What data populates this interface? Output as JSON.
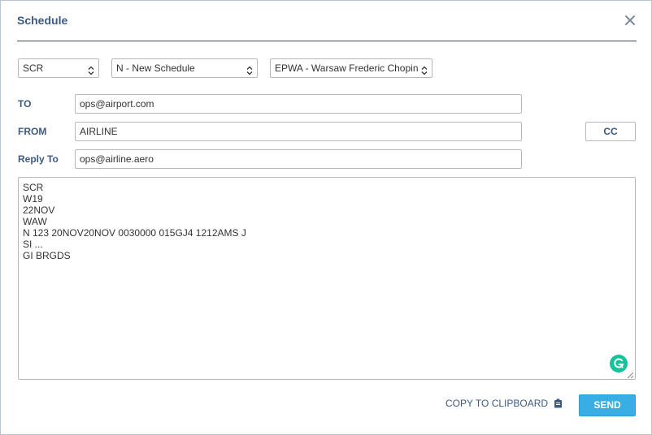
{
  "dialog": {
    "title": "Schedule"
  },
  "selects": {
    "message_type": "SCR",
    "action": "N - New Schedule",
    "airport": "EPWA - Warsaw Frederic Chopin"
  },
  "fields": {
    "to_label": "TO",
    "to_value": "ops@airport.com",
    "from_label": "FROM",
    "from_value": "AIRLINE",
    "reply_label": "Reply To",
    "reply_value": "ops@airline.aero",
    "cc_label": "CC"
  },
  "message": {
    "lines": [
      "SCR",
      "W19",
      "22NOV",
      "WAW",
      "N 123 20NOV20NOV 0030000 015GJ4 1212AMS J",
      "SI ...",
      "GI BRGDS"
    ]
  },
  "footer": {
    "copy_label": "COPY TO CLIPBOARD",
    "send_label": "SEND"
  },
  "colors": {
    "accent": "#3d5a80",
    "send": "#39aee4",
    "grammarly": "#15c39a"
  },
  "icons": {
    "close": "close-icon",
    "caret": "sort-caret-icon",
    "clipboard": "clipboard-icon",
    "grammarly": "grammarly-icon"
  }
}
